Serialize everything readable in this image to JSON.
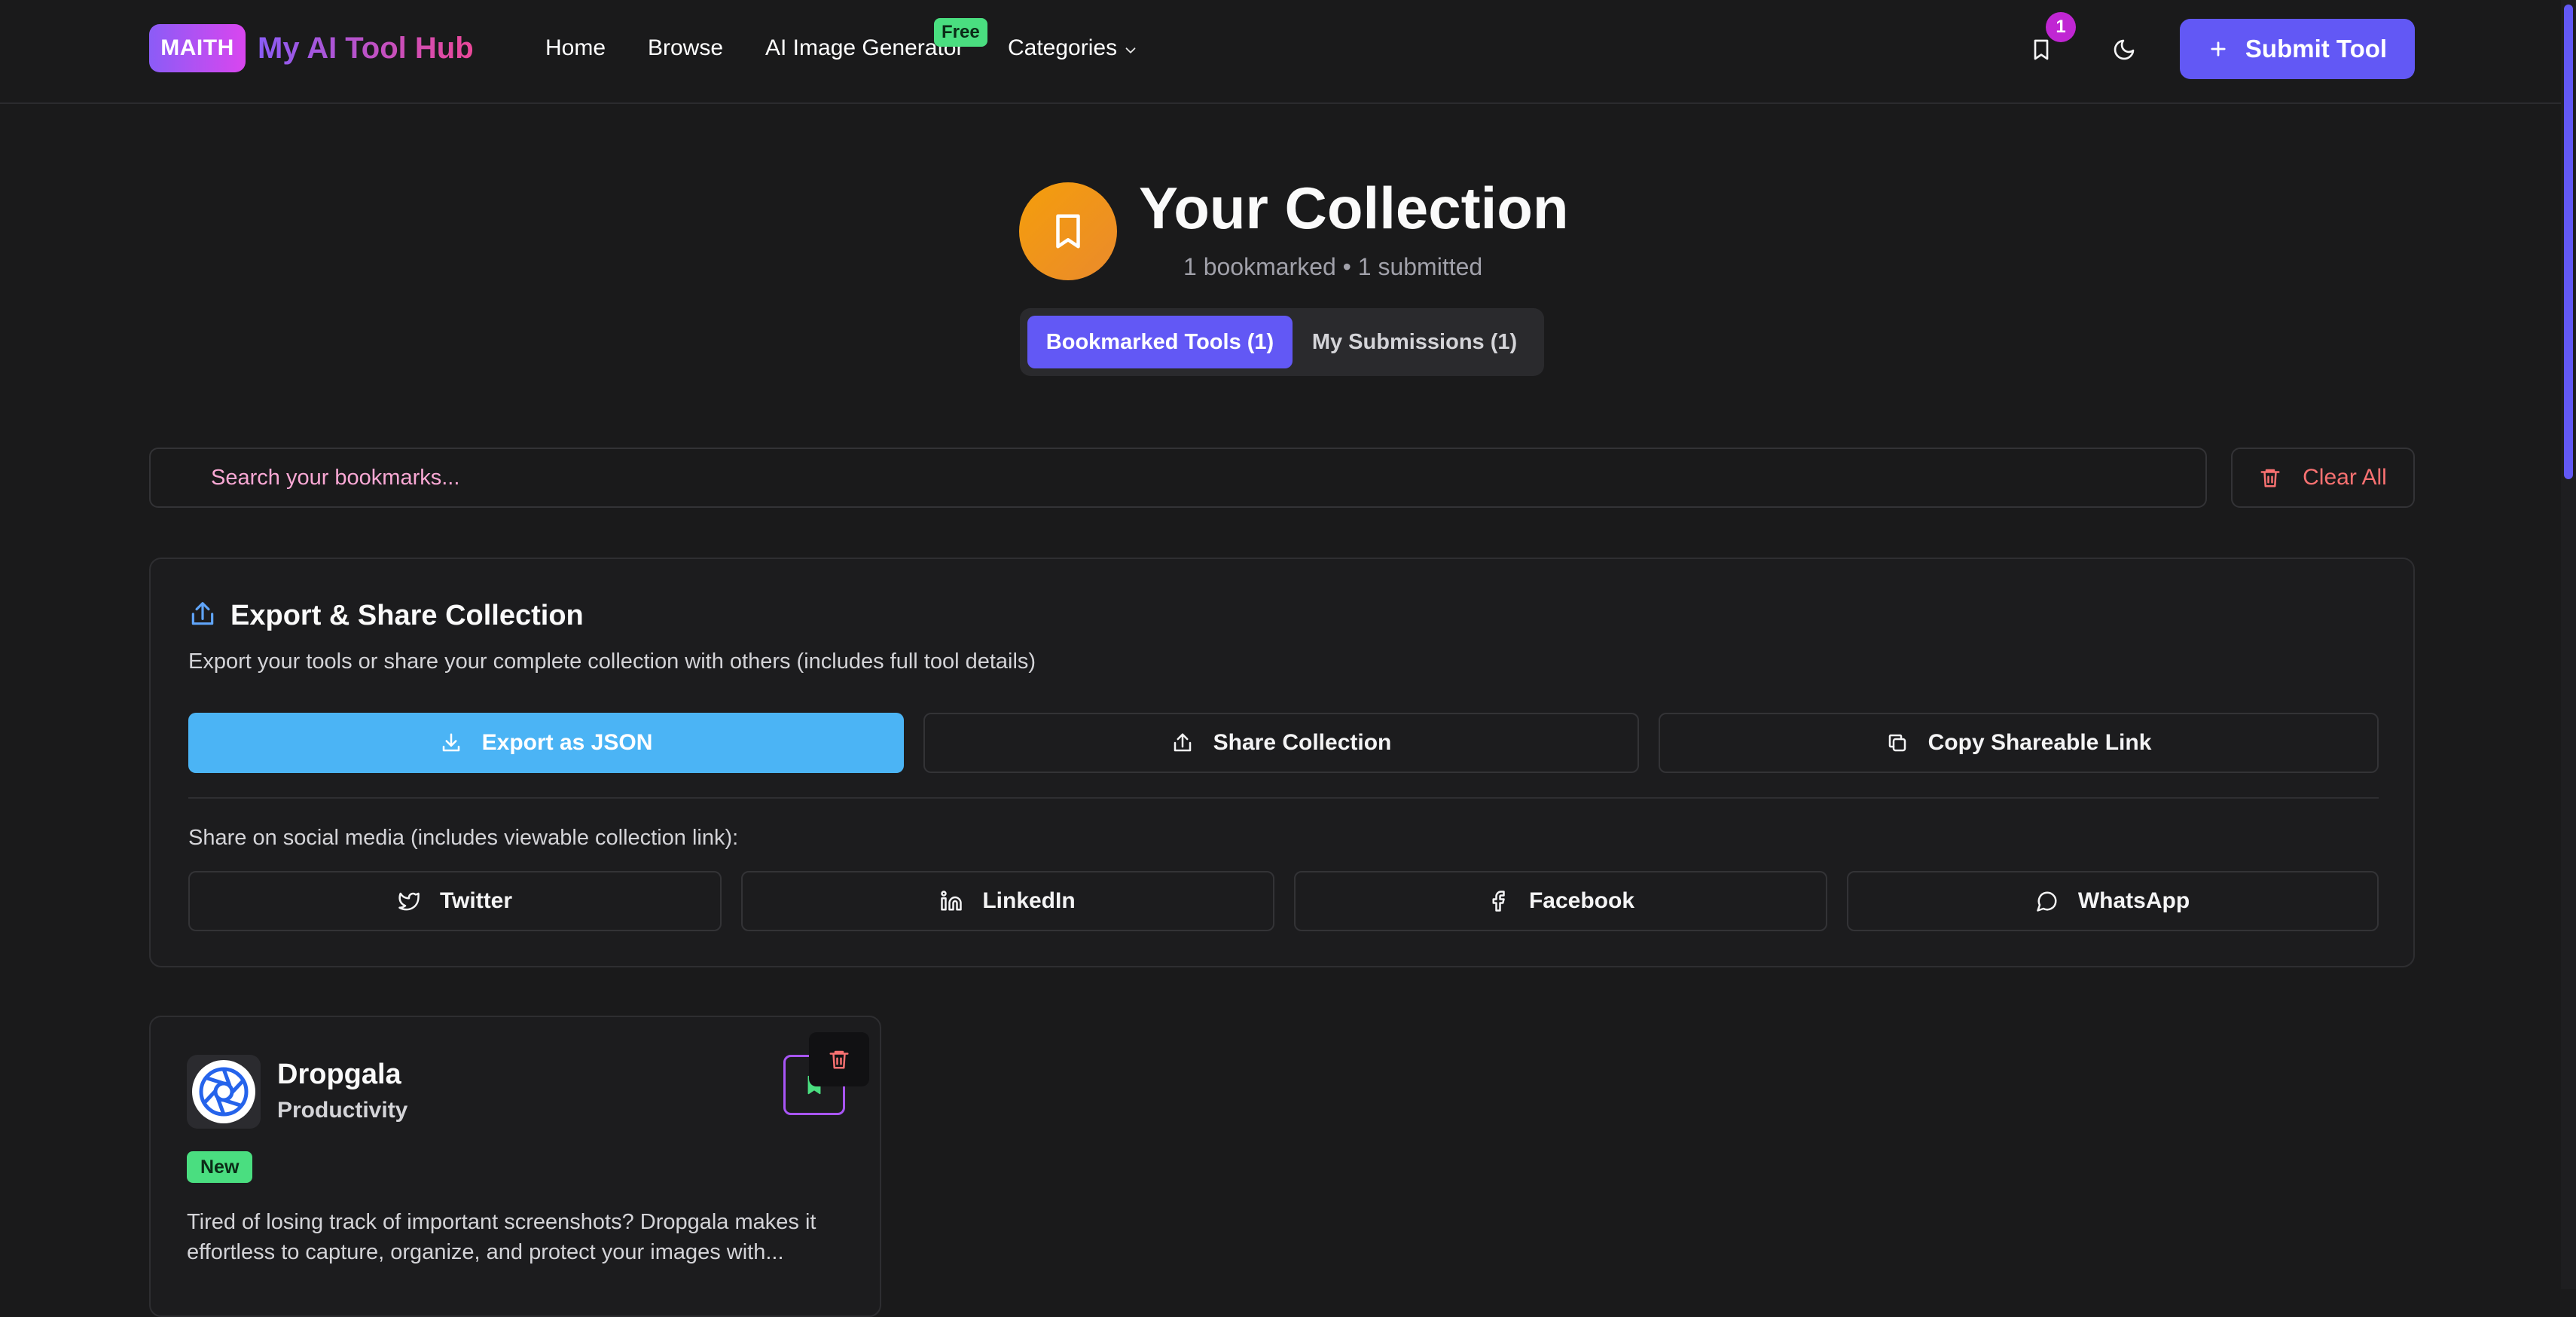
{
  "navbar": {
    "logo_badge": "MAITH",
    "brand": "My AI Tool Hub",
    "links": [
      "Home",
      "Browse",
      "AI Image Generator",
      "Categories"
    ],
    "free_badge": "Free",
    "bookmark_count": "1",
    "submit_label": "Submit Tool"
  },
  "hero": {
    "title": "Your Collection",
    "subtitle": "1 bookmarked • 1 submitted",
    "tabs": [
      "Bookmarked Tools (1)",
      "My Submissions (1)"
    ]
  },
  "search": {
    "placeholder": "Search your bookmarks...",
    "clear_label": "Clear All"
  },
  "export": {
    "title": "Export & Share Collection",
    "description": "Export your tools or share your complete collection with others (includes full tool details)",
    "actions": [
      "Export as JSON",
      "Share Collection",
      "Copy Shareable Link"
    ],
    "social_label": "Share on social media (includes viewable collection link):",
    "social": [
      "Twitter",
      "LinkedIn",
      "Facebook",
      "WhatsApp"
    ]
  },
  "tool": {
    "name": "Dropgala",
    "category": "Productivity",
    "badge": "New",
    "description": "Tired of losing track of important screenshots? Dropgala makes it effortless to capture, organize, and protect your images with..."
  },
  "colors": {
    "accent": "#6258f5",
    "export_primary": "#4bb4f5",
    "danger": "#f87171",
    "badge_green": "#4ade80",
    "hero_icon": "#f59e0b"
  },
  "icons": [
    "bookmark-icon",
    "moon-icon",
    "plus-icon",
    "trash-icon",
    "share-icon",
    "download-icon",
    "copy-icon",
    "twitter-icon",
    "linkedin-icon",
    "facebook-icon",
    "whatsapp-icon",
    "chevron-down-icon"
  ]
}
